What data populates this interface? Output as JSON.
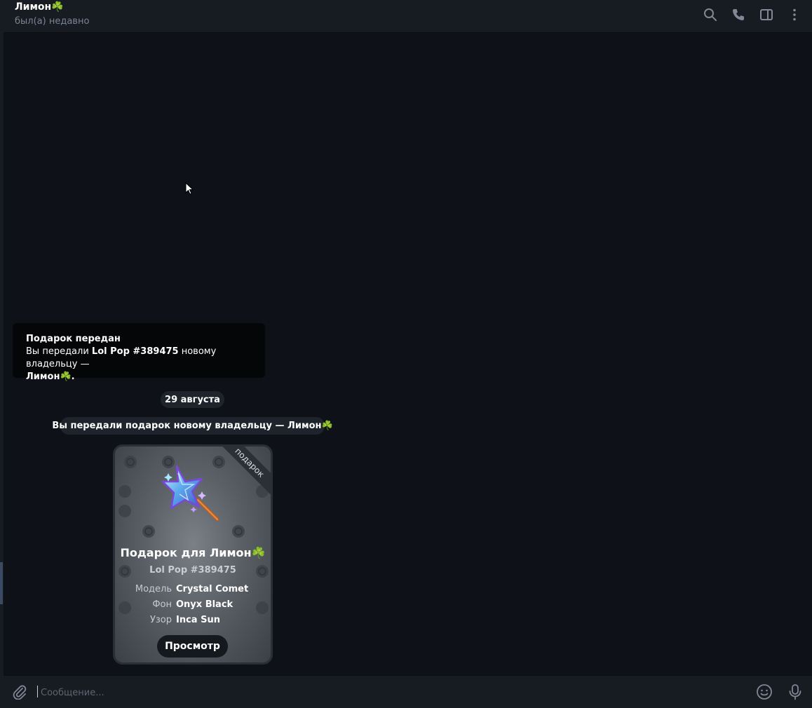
{
  "header": {
    "title": "Лимон☘️",
    "status": "был(а) недавно",
    "icons": [
      "search-icon",
      "phone-icon",
      "sidebar-icon",
      "more-vertical-icon"
    ]
  },
  "service_card": {
    "title": "Подарок передан",
    "line_prefix": "Вы передали ",
    "gift_name": "Lol Pop #389475",
    "line_middle": " новому владельцу —",
    "recipient": "Лимон☘️",
    "end": "."
  },
  "date_separator": "29 августа",
  "service_message": "Вы передали подарок новому владельцу — Лимон☘️",
  "gift": {
    "ribbon": "подарок",
    "title": "Подарок для Лимон☘️",
    "subtitle": "Lol Pop #389475",
    "attributes": [
      {
        "key": "Модель",
        "value": "Crystal Comet"
      },
      {
        "key": "Фон",
        "value": "Onyx Black"
      },
      {
        "key": "Узор",
        "value": "Inca Sun"
      }
    ],
    "button": "Просмотр"
  },
  "composer": {
    "placeholder": "Сообщение...",
    "icons": [
      "paperclip-icon",
      "emoji-icon",
      "microphone-icon"
    ]
  },
  "colors": {
    "background": "#0e1117",
    "header": "#171b22",
    "pill": "#1e232c",
    "service_card": "#050608",
    "muted_text": "#7b8591"
  }
}
